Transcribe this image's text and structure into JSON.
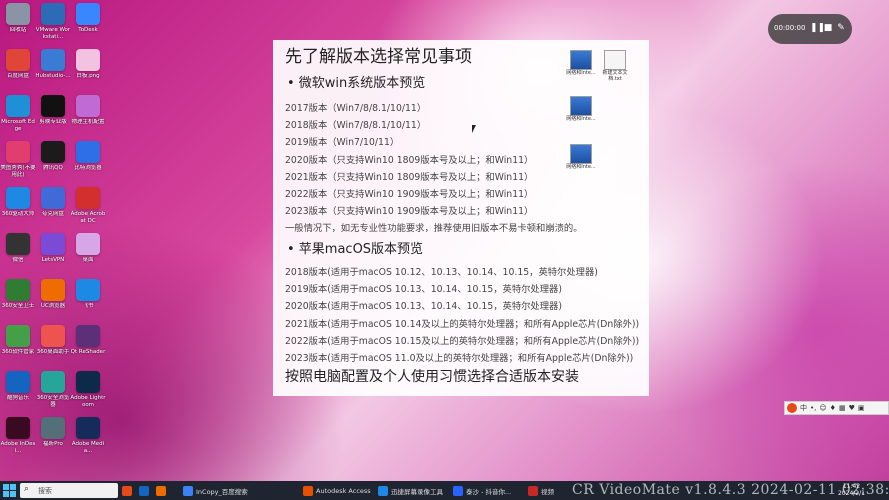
{
  "desktop_icons": [
    {
      "label": "回收站",
      "color": "#8a94a6"
    },
    {
      "label": "VMware Workstati...",
      "color": "#2c6cb6"
    },
    {
      "label": "ToDesk",
      "color": "#3a86ff"
    },
    {
      "label": "百度网盘",
      "color": "#e0453a"
    },
    {
      "label": "Hubstudio-...",
      "color": "#3a7bd5"
    },
    {
      "label": "白板.png",
      "color": "#f2c2e0"
    },
    {
      "label": "Microsoft Edge",
      "color": "#1f8fd6"
    },
    {
      "label": "剪映专业版",
      "color": "#111111"
    },
    {
      "label": "物理主机配置",
      "color": "#c06bd4"
    },
    {
      "label": "美图秀秀(不要用此)",
      "color": "#e13d6f"
    },
    {
      "label": "腾讯QQ",
      "color": "#1b1b1b"
    },
    {
      "label": "比特浏览器",
      "color": "#2e6ee6"
    },
    {
      "label": "360驱动大师",
      "color": "#1e88e5"
    },
    {
      "label": "夸克网盘",
      "color": "#3f6ad8"
    },
    {
      "label": "Adobe Acrobat DC",
      "color": "#d32f2f"
    },
    {
      "label": "微信",
      "color": "#333333"
    },
    {
      "label": "LetsVPN",
      "color": "#7b4ad6"
    },
    {
      "label": "桌面",
      "color": "#d7a6e6"
    },
    {
      "label": "360安全卫士",
      "color": "#2e7d32"
    },
    {
      "label": "UC浏览器",
      "color": "#ef6c00"
    },
    {
      "label": "飞书",
      "color": "#1e88e5"
    },
    {
      "label": "360软件管家",
      "color": "#43a047"
    },
    {
      "label": "360桌面助手",
      "color": "#ef5350"
    },
    {
      "label": "Qt ReShader",
      "color": "#5c2f78"
    },
    {
      "label": "酷狗音乐",
      "color": "#1565c0"
    },
    {
      "label": "360安全浏览器",
      "color": "#26a69a"
    },
    {
      "label": "Adobe Lightroom",
      "color": "#0d2a4a"
    },
    {
      "label": "Adobe InDesi...",
      "color": "#3a0b20"
    },
    {
      "label": "福昕Pro",
      "color": "#546e7a"
    },
    {
      "label": "Adobe Media...",
      "color": "#172b5a"
    }
  ],
  "recorder": {
    "time": "00:00:00"
  },
  "slide": {
    "title": "先了解版本选择常见事项",
    "win_heading": "• 微软win系统版本预览",
    "win_rows": [
      "2017版本（Win7/8/8.1/10/11）",
      "2018版本（Win7/8/8.1/10/11）",
      "2019版本（Win7/10/11）",
      "2020版本（只支持Win10 1809版本号及以上；和Win11）",
      "2021版本（只支持Win10 1809版本号及以上；和Win11）",
      "2022版本（只支持Win10 1909版本号及以上；和Win11）",
      "2023版本（只支持Win10 1909版本号及以上；和Win11）"
    ],
    "note": "一般情况下，如无专业性功能要求，推荐使用旧版本不易卡顿和崩溃的。",
    "mac_heading": "• 苹果macOS版本预览",
    "mac_rows": [
      "2018版本(适用于macOS 10.12、10.13、10.14、10.15，英特尔处理器)",
      "2019版本(适用于macOS 10.13、10.14、10.15，英特尔处理器)",
      "2020版本(适用于macOS 10.13、10.14、10.15，英特尔处理器)",
      "2021版本(适用于macOS 10.14及以上的英特尔处理器；和所有Apple芯片(Dn除外))",
      "2022版本(适用于macOS 10.15及以上的英特尔处理器；和所有Apple芯片(Dn除外))",
      "2023版本(适用于macOS 11.0及以上的英特尔处理器；和所有Apple芯片(Dn除外))"
    ],
    "footer": "按照电脑配置及个人使用习惯选择合适版本安装"
  },
  "file_icons": [
    {
      "label": "网络和Inte..."
    },
    {
      "label": "新建文本文档.txt"
    },
    {
      "label": "网络和Inte..."
    },
    {
      "label": "网络和Inte..."
    }
  ],
  "ime_bar": {
    "lang": "中"
  },
  "taskbar": {
    "search_text": "搜索",
    "apps": [
      {
        "title": "InCopy_百度搜索",
        "color": "#3b82f6"
      },
      {
        "title": "Autodesk Access",
        "color": "#e65100"
      },
      {
        "title": "迅捷屏幕录像工具",
        "color": "#1e88e5"
      },
      {
        "title": "泰沙 - 抖音你...",
        "color": "#2962ff"
      },
      {
        "title": "视频",
        "color": "#c62828"
      }
    ],
    "clock_time": "11:42",
    "clock_date": "2024/2/1"
  },
  "watermark": "CR VideoMate v1.8.4.3  2024-02-11 02:38:55"
}
